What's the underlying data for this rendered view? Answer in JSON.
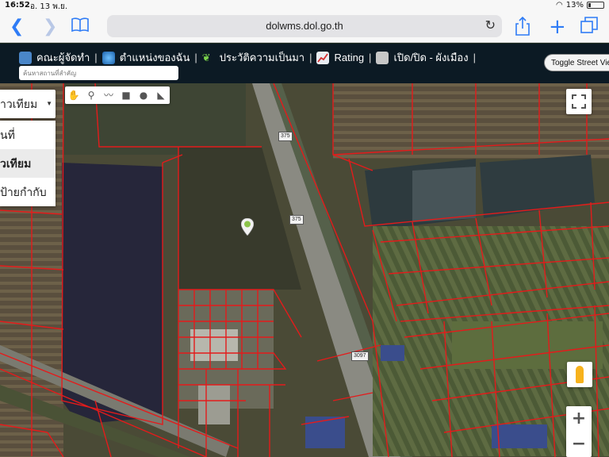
{
  "status": {
    "time": "16:52",
    "date": "อ. 13 พ.ย.",
    "battery": "13%"
  },
  "browser": {
    "url": "dolwms.dol.go.th"
  },
  "header": {
    "menu": [
      {
        "label": "คณะผู้จัดทำ",
        "icon": "people-icon"
      },
      {
        "label": "ตำแหน่งของฉัน",
        "icon": "globe-icon"
      },
      {
        "label": "ประวัติความเป็นมา",
        "icon": "sprout-icon"
      },
      {
        "label": "Rating",
        "icon": "chart-icon"
      },
      {
        "label": "เปิด/ปิด - ผังเมือง",
        "icon": "square-icon"
      }
    ],
    "search_placeholder": "ค้นหาสถานที่สำคัญ",
    "street_view": "Toggle Street View"
  },
  "map": {
    "type_selected": "าวเทียม",
    "type_options": [
      "นที่",
      "วเทียม",
      "ป้ายกำกับ"
    ],
    "road_labels": [
      "375",
      "375",
      "3097"
    ],
    "zoom_in": "+",
    "zoom_out": "−",
    "colors": {
      "parcel": "#e41b1b",
      "header": "#0c1a24",
      "accent": "#2f7cf6"
    }
  }
}
